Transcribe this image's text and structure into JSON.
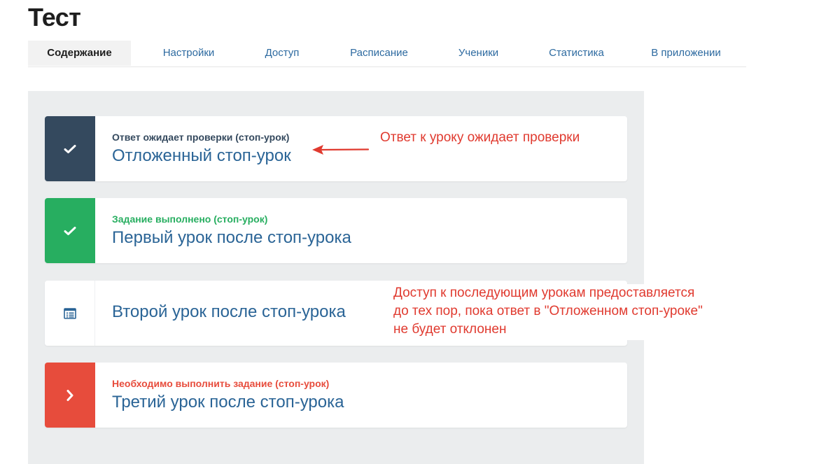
{
  "page": {
    "title": "Тест"
  },
  "tabs": [
    {
      "label": "Содержание",
      "active": true
    },
    {
      "label": "Настройки",
      "active": false
    },
    {
      "label": "Доступ",
      "active": false
    },
    {
      "label": "Расписание",
      "active": false
    },
    {
      "label": "Ученики",
      "active": false
    },
    {
      "label": "Статистика",
      "active": false
    },
    {
      "label": "В приложении",
      "active": false
    }
  ],
  "lessons": [
    {
      "status": "Ответ ожидает проверки (стоп-урок)",
      "title": "Отложенный стоп-урок",
      "icon": "check-icon",
      "icon_bg": "#34495e",
      "status_color": "#34495e"
    },
    {
      "status": "Задание выполнено (стоп-урок)",
      "title": "Первый урок после стоп-урока",
      "icon": "check-icon",
      "icon_bg": "#27ae60",
      "status_color": "#27ae60"
    },
    {
      "status": "",
      "title": "Второй урок после стоп-урока",
      "icon": "document-list-icon",
      "icon_bg": "#ffffff",
      "status_color": ""
    },
    {
      "status": "Необходимо выполнить задание (стоп-урок)",
      "title": "Третий урок после стоп-урока",
      "icon": "chevron-right-icon",
      "icon_bg": "#e74c3c",
      "status_color": "#e74c3c"
    }
  ],
  "annotations": {
    "first": "Ответ к уроку ожидает проверки",
    "second_line1": "Доступ к последующим урокам предоставляется",
    "second_line2": "до тех пор, пока ответ в \"Отложенном стоп-уроке\"",
    "second_line3": "не будет отклонен"
  },
  "colors": {
    "accent_link": "#2a6496",
    "annotation": "#e03a2f",
    "panel_bg": "#ebedee"
  }
}
